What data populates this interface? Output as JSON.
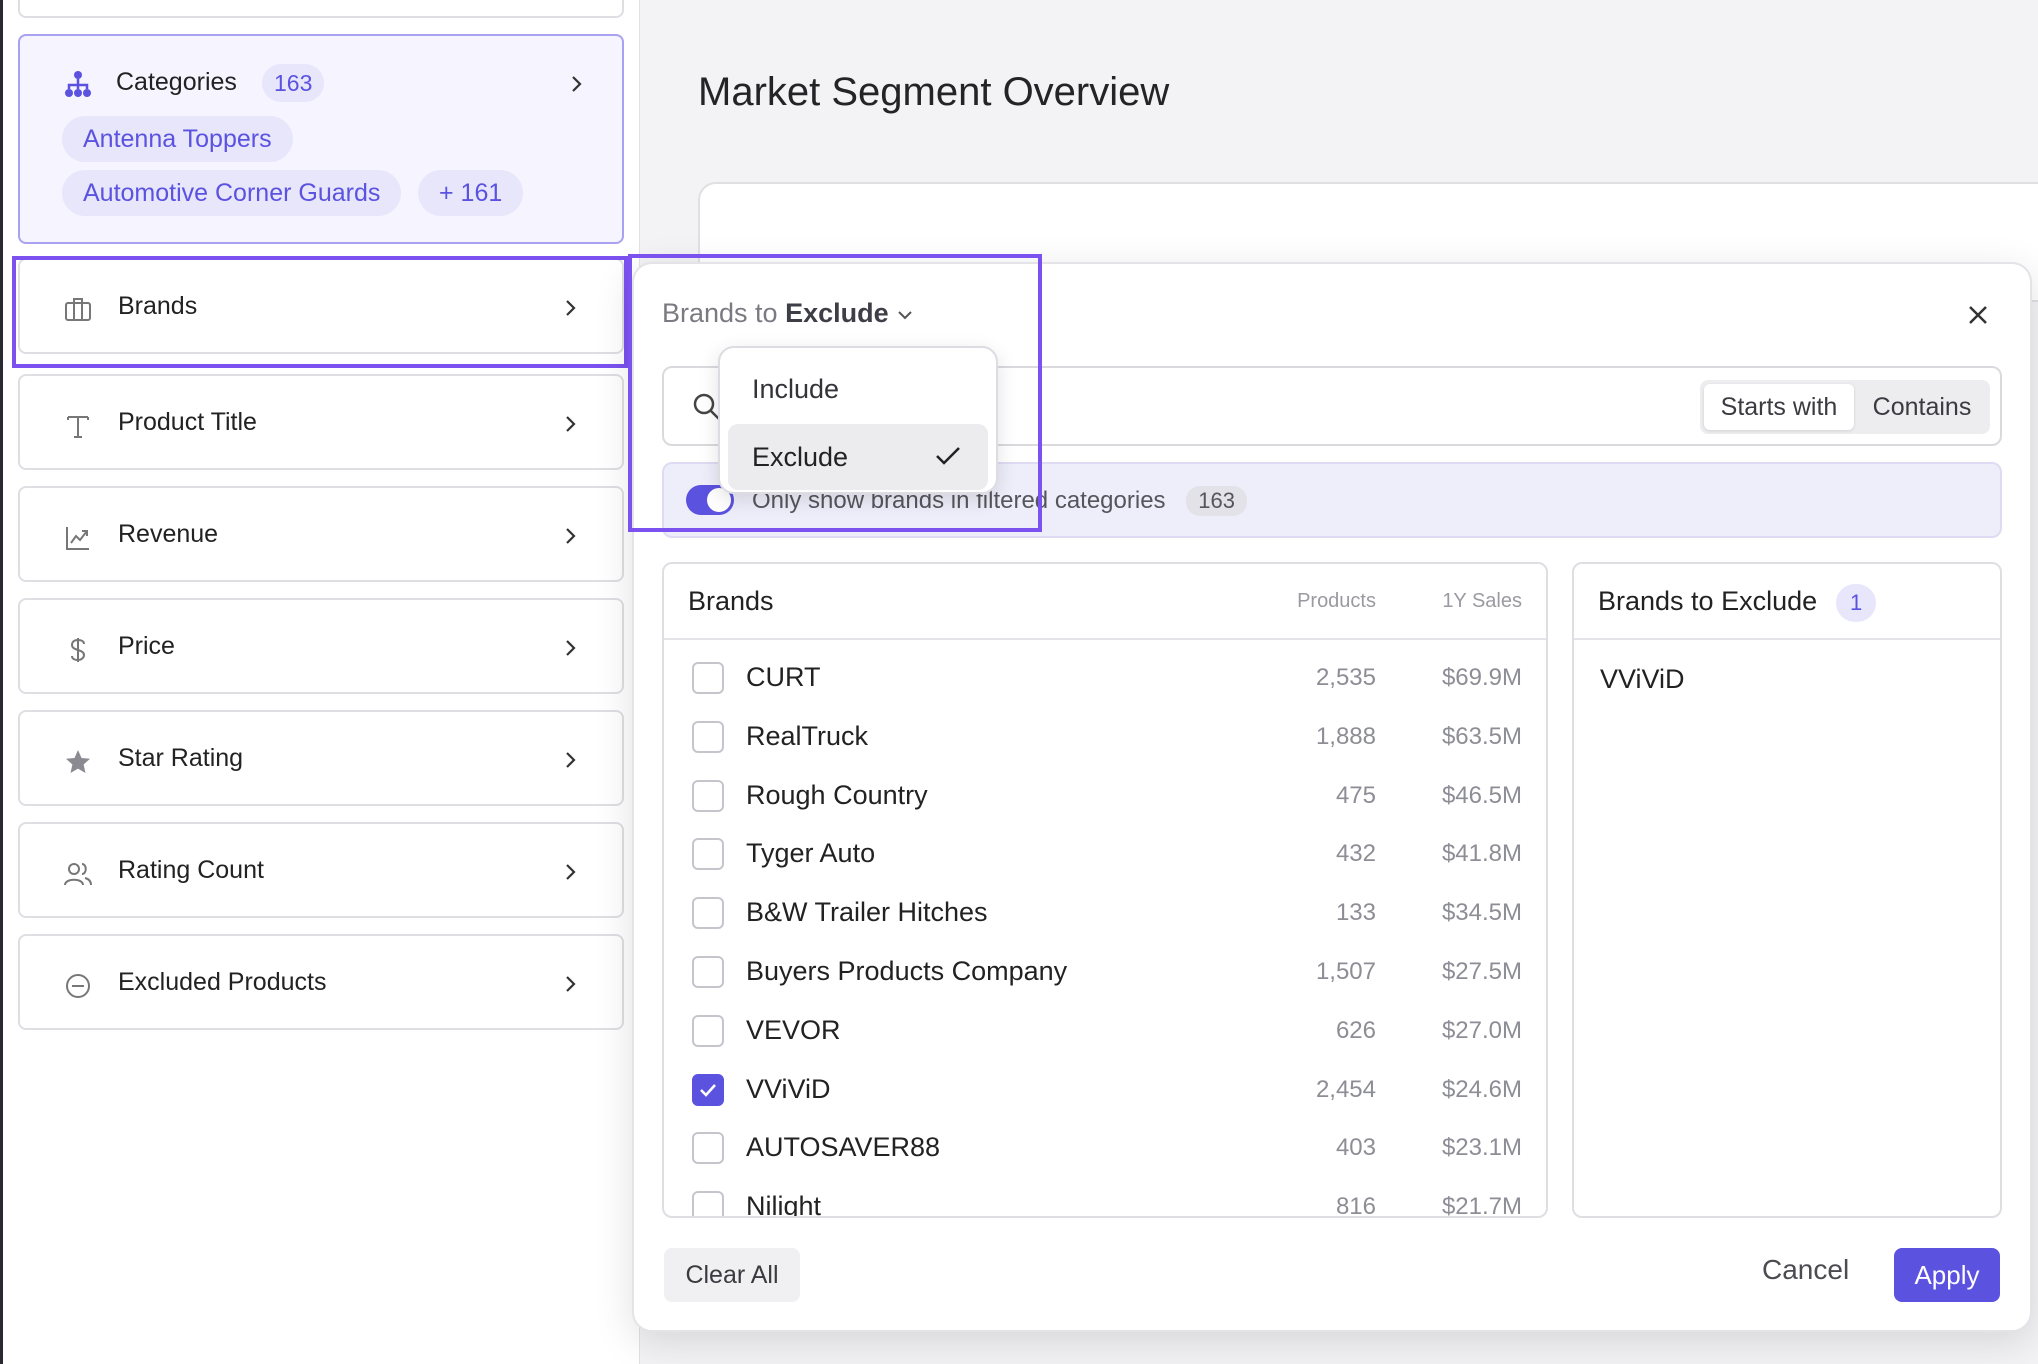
{
  "sidebar": {
    "categories": {
      "label": "Categories",
      "count": "163",
      "chips": [
        "Antenna Toppers",
        "Automotive Corner Guards"
      ],
      "more": "+ 161"
    },
    "items": [
      {
        "label": "Brands",
        "icon": "briefcase-icon"
      },
      {
        "label": "Product Title",
        "icon": "text-icon"
      },
      {
        "label": "Revenue",
        "icon": "chart-icon"
      },
      {
        "label": "Price",
        "icon": "dollar-icon"
      },
      {
        "label": "Star Rating",
        "icon": "star-icon"
      },
      {
        "label": "Rating Count",
        "icon": "users-icon"
      },
      {
        "label": "Excluded Products",
        "icon": "minus-circle-icon"
      }
    ]
  },
  "main": {
    "title": "Market Segment Overview"
  },
  "modal": {
    "header_prefix": "Brands to",
    "header_mode": "Exclude",
    "search_modes": [
      "Starts with",
      "Contains"
    ],
    "filter_text": "Only show brands in filtered categories",
    "filter_count": "163",
    "dropdown": {
      "include": "Include",
      "exclude": "Exclude"
    },
    "brands_table": {
      "title": "Brands",
      "col_products": "Products",
      "col_sales": "1Y Sales",
      "rows": [
        {
          "name": "CURT",
          "products": "2,535",
          "sales": "$69.9M",
          "checked": false
        },
        {
          "name": "RealTruck",
          "products": "1,888",
          "sales": "$63.5M",
          "checked": false
        },
        {
          "name": "Rough Country",
          "products": "475",
          "sales": "$46.5M",
          "checked": false
        },
        {
          "name": "Tyger Auto",
          "products": "432",
          "sales": "$41.8M",
          "checked": false
        },
        {
          "name": "B&W Trailer Hitches",
          "products": "133",
          "sales": "$34.5M",
          "checked": false
        },
        {
          "name": "Buyers Products Company",
          "products": "1,507",
          "sales": "$27.5M",
          "checked": false
        },
        {
          "name": "VEVOR",
          "products": "626",
          "sales": "$27.0M",
          "checked": false
        },
        {
          "name": "VViViD",
          "products": "2,454",
          "sales": "$24.6M",
          "checked": true
        },
        {
          "name": "AUTOSAVER88",
          "products": "403",
          "sales": "$23.1M",
          "checked": false
        },
        {
          "name": "Nilight",
          "products": "816",
          "sales": "$21.7M",
          "checked": false
        }
      ]
    },
    "excluded": {
      "title": "Brands to Exclude",
      "count": "1",
      "items": [
        "VViViD"
      ]
    },
    "buttons": {
      "clear": "Clear All",
      "cancel": "Cancel",
      "apply": "Apply"
    }
  },
  "colors": {
    "accent": "#5b52e0",
    "selection": "#7b52f0"
  }
}
